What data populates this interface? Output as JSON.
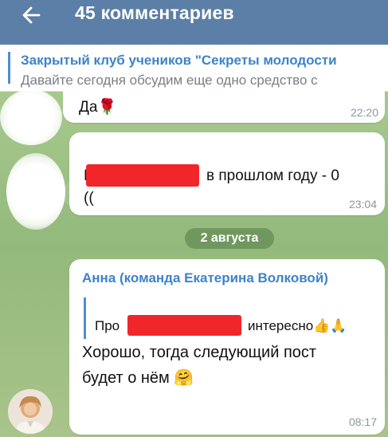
{
  "header": {
    "title": "45 комментариев"
  },
  "pinned": {
    "title": "Закрытый клуб учеников \"Секреты молодости",
    "text": "Давайте сегодня обсудим еще одно средство с"
  },
  "messages": [
    {
      "text": "Да",
      "emoji": "🌹",
      "time": "22:20"
    },
    {
      "prefix": "М",
      "text_line1": "в прошлом году - 0",
      "text_line2": "((",
      "time": "23:04"
    },
    {
      "author": "Анна (команда Екатерина Волковой)",
      "reply_prefix": "Про",
      "reply_suffix": "интересно",
      "reply_emoji": "👍🙏",
      "text_line1": "Хорошо, тогда следующий пост",
      "text_line2": "будет о нём",
      "emoji": "🤗",
      "time": "08:17"
    }
  ],
  "date_separator": "2 августа",
  "icons": {
    "back": "arrow-left-icon",
    "avatar": "user-avatar"
  },
  "colors": {
    "header_bg": "#5b7fa6",
    "accent": "#3d83c9",
    "chat_bg": "#9cbf86",
    "redaction": "#f0262b"
  }
}
